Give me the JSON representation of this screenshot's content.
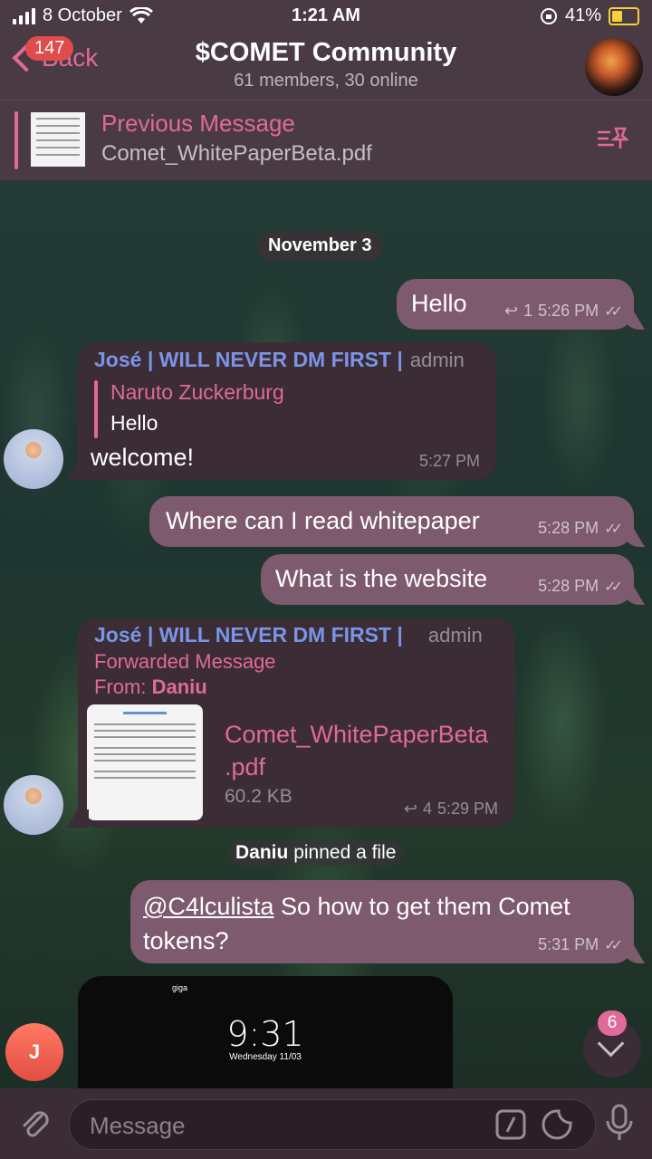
{
  "status": {
    "date": "8 October",
    "time": "1:21 AM",
    "battery": "41%"
  },
  "header": {
    "back_label": "Back",
    "unread_count": "147",
    "title": "$COMET Community",
    "subtitle": "61 members, 30 online"
  },
  "pinned": {
    "title": "Previous Message",
    "file": "Comet_WhitePaperBeta.pdf"
  },
  "chat": {
    "date_pill": "November 3",
    "m1": {
      "text": "Hello",
      "reply_count": "1",
      "time": "5:26 PM"
    },
    "m2": {
      "sender": "José | WILL NEVER DM FIRST |",
      "role": "admin",
      "reply_name": "Naruto Zuckerburg",
      "reply_text": "Hello",
      "text": "welcome!",
      "time": "5:27 PM"
    },
    "m3": {
      "text": "Where can I read whitepaper",
      "time": "5:28 PM"
    },
    "m4": {
      "text": "What is the website",
      "time": "5:28 PM"
    },
    "m5": {
      "sender": "José | WILL NEVER DM FIRST |",
      "role": "admin",
      "forwarded": "Forwarded Message",
      "from_label": "From:",
      "from_name": "Daniu",
      "file_name_1": "Comet_WhitePaperBeta",
      "file_name_2": ".pdf",
      "file_size": "60.2 KB",
      "reply_count": "4",
      "time": "5:29 PM"
    },
    "system": {
      "name": "Daniu",
      "text": "pinned a file"
    },
    "m6": {
      "mention": "@C4lculista",
      "text": " So how to get them Comet tokens?",
      "time": "5:31 PM"
    },
    "screenshot": {
      "time": "9:31",
      "date": "Wednesday 11/03",
      "carrier": "giga"
    }
  },
  "fab": {
    "unread": "6",
    "avatar_letter": "J"
  },
  "composer": {
    "placeholder": "Message"
  }
}
